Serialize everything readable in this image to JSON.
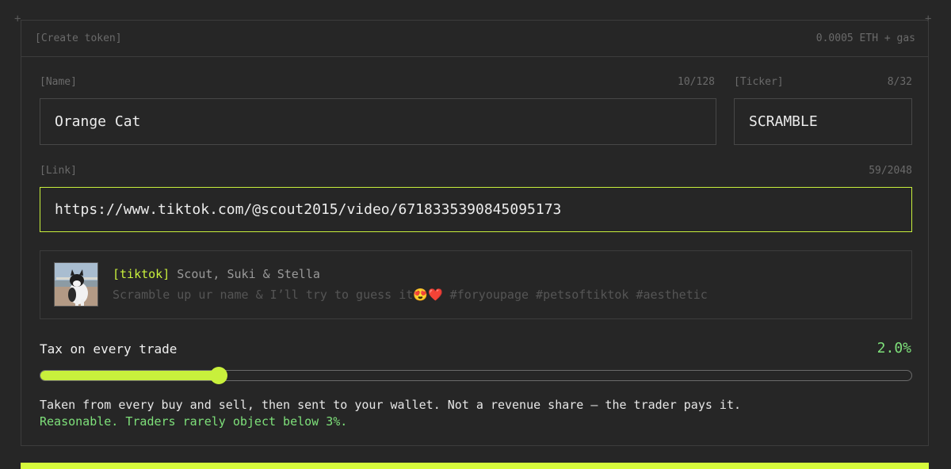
{
  "header": {
    "title": "[Create token]",
    "cost": "0.0005 ETH + gas"
  },
  "name_field": {
    "label": "[Name]",
    "count": "10/128",
    "value": "Orange Cat"
  },
  "ticker_field": {
    "label": "[Ticker]",
    "count": "8/32",
    "value": "SCRAMBLE"
  },
  "link_field": {
    "label": "[Link]",
    "count": "59/2048",
    "value": "https://www.tiktok.com/@scout2015/video/6718335390845095173"
  },
  "preview": {
    "source": "[tiktok]",
    "author": "Scout, Suki & Stella",
    "description": "Scramble up ur name & I’ll try to guess it😍❤️ #foryoupage #petsoftiktok #aesthetic"
  },
  "tax": {
    "label": "Tax on every trade",
    "value_text": "2.0%",
    "slider_fraction": 0.205,
    "help": "Taken from every buy and sell, then sent to your wallet. Not a revenue share — the trader pays it.",
    "assessment": "Reasonable. Traders rarely object below 3%."
  },
  "colors": {
    "accent": "#c8f03c",
    "positive": "#7ee07a",
    "background": "#262626"
  }
}
